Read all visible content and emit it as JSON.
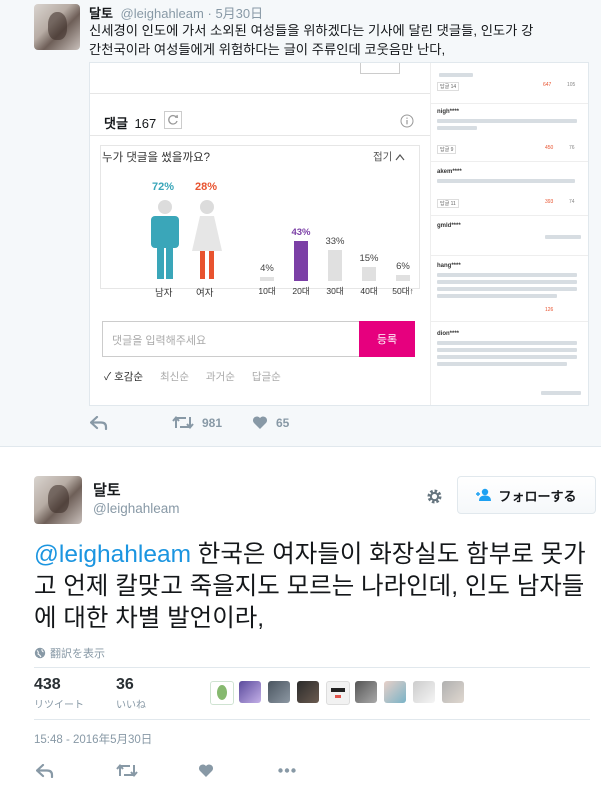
{
  "tweet1": {
    "name": "달토",
    "handle": "@leighahleam",
    "date": "5月30日",
    "text_line1": "신세경이 인도에 가서 소외된 여성들을 위하겠다는 기사에 달린 댓글들, 인도가 강",
    "text_line2": "간천국이라 여성들에게 위험하다는 글이 주류인데 코웃음만 난다,",
    "retweets": "981",
    "likes": "65"
  },
  "embed": {
    "comments_label": "댓글",
    "comments_count": "167",
    "who_wrote": "누가 댓글을 썼을까요?",
    "collapse": "접기",
    "male_pct": "72%",
    "female_pct": "28%",
    "male_label": "남자",
    "female_label": "여자",
    "input_placeholder": "댓글을 입력해주세요",
    "submit_label": "등록",
    "sort_options": [
      "✓ 호감순",
      "최신순",
      "과거순",
      "답글순"
    ],
    "colors": {
      "male": "#3aa6b9",
      "female": "#e8532f",
      "accent": "#e6007e",
      "age_highlight": "#7b3fa6"
    }
  },
  "chart_data": {
    "type": "bar",
    "categories": [
      "10대",
      "20대",
      "30대",
      "40대",
      "50대↑"
    ],
    "values": [
      4,
      43,
      33,
      15,
      6
    ],
    "value_labels": [
      "4%",
      "43%",
      "33%",
      "15%",
      "6%"
    ],
    "highlight_index": 1
  },
  "side_comments": [
    {
      "user": "",
      "reply": "답글 14",
      "likes": "647",
      "dislikes": "105"
    },
    {
      "user": "nigh****",
      "reply": "답글 9",
      "likes": "450",
      "dislikes": "76"
    },
    {
      "user": "akem****",
      "reply": "답글 11",
      "likes": "393",
      "dislikes": "74"
    },
    {
      "user": "gmld****",
      "reply": "",
      "likes": "",
      "dislikes": ""
    },
    {
      "user": "hang****",
      "reply": "",
      "likes": "126",
      "dislikes": ""
    },
    {
      "user": "dion****",
      "reply": "",
      "likes": "",
      "dislikes": ""
    }
  ],
  "tweet2": {
    "name": "달토",
    "handle": "@leighahleam",
    "follow_label": "フォローする",
    "mention": "@leighahleam",
    "text": " 한국은 여자들이 화장실도 함부로 못가고 언제 칼맞고 죽을지도 모르는 나라인데, 인도 남자들에 대한 차별 발언이라,",
    "translate": "翻訳を表示",
    "retweet_count": "438",
    "retweet_label": "リツイート",
    "like_count": "36",
    "like_label": "いいね",
    "timestamp": "15:48 - 2016年5月30日"
  },
  "icons": [
    "reply-icon",
    "retweet-icon",
    "heart-icon",
    "more-icon",
    "gear-icon",
    "globe-icon",
    "refresh-icon",
    "info-icon",
    "chevron-up-icon"
  ]
}
